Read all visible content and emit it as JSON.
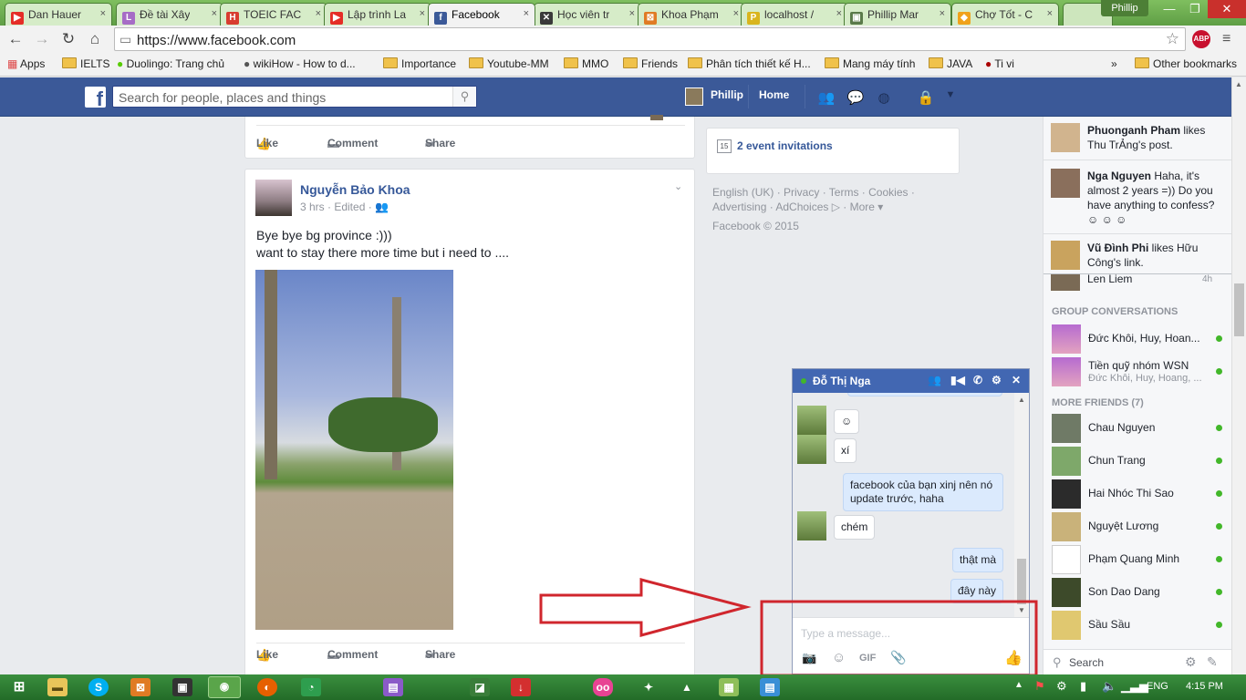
{
  "tabs": [
    {
      "label": "Dan Hauer",
      "fav_color": "#e52d27",
      "fav": "▶"
    },
    {
      "label": "Đề tài Xây",
      "fav_color": "#a66cc6",
      "fav": "L"
    },
    {
      "label": "TOEIC FAC",
      "fav_color": "#d83c2f",
      "fav": "H"
    },
    {
      "label": "Lập trình La",
      "fav_color": "#e52d27",
      "fav": "▶"
    },
    {
      "label": "Facebook",
      "fav_color": "#3b5998",
      "fav": "f"
    },
    {
      "label": "Học viên tr",
      "fav_color": "#3a3a3a",
      "fav": "✕"
    },
    {
      "label": "Khoa Phạm",
      "fav_color": "#e07b24",
      "fav": "⊠"
    },
    {
      "label": "localhost /",
      "fav_color": "#d9b51e",
      "fav": "P"
    },
    {
      "label": "Phillip Mar",
      "fav_color": "#5a7a4a",
      "fav": "▣"
    },
    {
      "label": "Chợ Tốt - C",
      "fav_color": "#f0a21b",
      "fav": "◆"
    }
  ],
  "profile_name": "Phillip",
  "url": "https://www.facebook.com",
  "adblock": "ABP",
  "bookmarks": [
    {
      "label": "Apps",
      "type": "apps"
    },
    {
      "label": "IELTS",
      "type": "folder"
    },
    {
      "label": "Duolingo: Trang chủ",
      "type": "site"
    },
    {
      "label": "wikiHow - How to d...",
      "type": "site"
    },
    {
      "label": "Importance",
      "type": "folder"
    },
    {
      "label": "Youtube-MM",
      "type": "folder"
    },
    {
      "label": "MMO",
      "type": "folder"
    },
    {
      "label": "Friends",
      "type": "folder"
    },
    {
      "label": "Phân tích thiết kế H...",
      "type": "folder"
    },
    {
      "label": "Mang máy tính",
      "type": "folder"
    },
    {
      "label": "JAVA",
      "type": "folder"
    },
    {
      "label": "Ti vi",
      "type": "site"
    }
  ],
  "bookmarks_more": "»",
  "other_bookmarks": "Other bookmarks",
  "fb": {
    "search_placeholder": "Search for people, places and things",
    "user": "Phillip",
    "home": "Home"
  },
  "post_actions": {
    "like": "Like",
    "comment": "Comment",
    "share": "Share"
  },
  "post": {
    "author": "Nguyễn Bảo Khoa",
    "meta": "3 hrs · Edited ·",
    "line1": "Bye bye bg province :)))",
    "line2": "want to stay there more time but i need to ...."
  },
  "events": {
    "label": "2 event invitations",
    "icon_num": "15"
  },
  "footer": {
    "line1": "English (UK) · Privacy · Terms · Cookies ·",
    "line2": "Advertising · AdChoices ▷ · More ▾",
    "line3": "Facebook © 2015"
  },
  "ticker": [
    {
      "name": "Phuonganh Pham",
      "text": " likes Thu TrẢng's post."
    },
    {
      "name": "Nga Nguyen",
      "text": " Haha, it's almost 2 years =)) Do you have anything to confess? ☺ ☺ ☺"
    },
    {
      "name": "Vũ Đình Phi",
      "text": " likes Hữu Công's link."
    }
  ],
  "ticker_partial": {
    "name": "Len Liem",
    "time": "4h"
  },
  "group_header": "GROUP CONVERSATIONS",
  "groups": [
    {
      "name": "Đức Khôi, Huy, Hoan...",
      "sub": ""
    },
    {
      "name": "Tiền quỹ nhóm WSN",
      "sub": "Đức Khôi, Huy, Hoang, ..."
    }
  ],
  "more_friends_header": "MORE FRIENDS (7)",
  "friends": [
    "Chau Nguyen",
    "Chun Trang",
    "Hai Nhóc Thi Sao",
    "Nguyệt Lương",
    "Phạm Quang Minh",
    "Son Dao Dang",
    "Sầu Sầu"
  ],
  "sidebar_search": "Search",
  "chat": {
    "name": "Đỗ Thị Nga",
    "messages": [
      {
        "dir": "in",
        "text": "☺"
      },
      {
        "dir": "in",
        "text": "xí"
      },
      {
        "dir": "out",
        "text": "facebook của bạn xinj nên nó update trước, haha"
      },
      {
        "dir": "in",
        "text": "chém"
      },
      {
        "dir": "out",
        "text": "thật mà"
      },
      {
        "dir": "out",
        "text": "đây này"
      }
    ],
    "input_placeholder": "Type a message...",
    "gif": "GIF"
  },
  "taskbar": {
    "lang": "ENG",
    "time": "4:15 PM"
  },
  "colors": {
    "fb_blue": "#3b5998",
    "annotation_red": "#d0262d",
    "online_green": "#42b72a"
  }
}
